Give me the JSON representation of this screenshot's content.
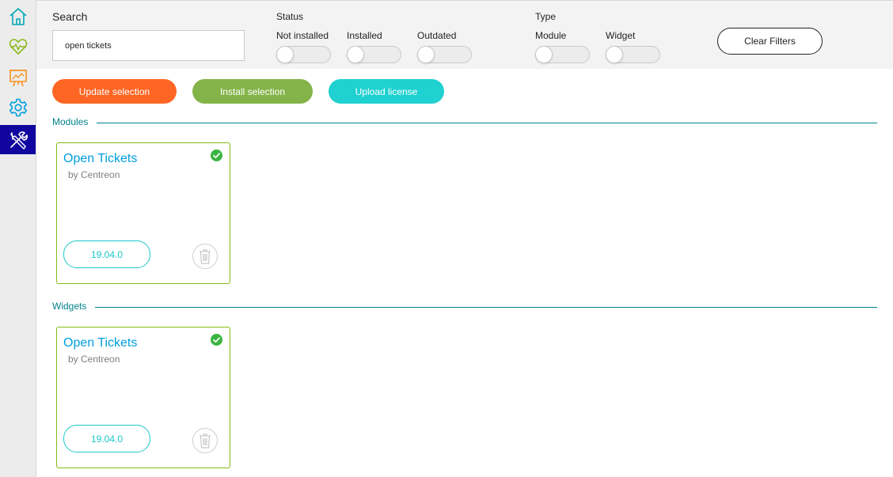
{
  "sidebar": {
    "items": [
      {
        "name": "home-icon",
        "color": "#00a8b5"
      },
      {
        "name": "monitoring-icon",
        "color": "#88b917"
      },
      {
        "name": "reporting-icon",
        "color": "#f7931e"
      },
      {
        "name": "configuration-icon",
        "color": "#009fdf"
      },
      {
        "name": "administration-icon",
        "color": "#ffffff",
        "active": true
      }
    ],
    "active_bg": "#10069f"
  },
  "filters": {
    "search": {
      "label": "Search",
      "value": "open tickets"
    },
    "status": {
      "label": "Status",
      "options": [
        {
          "label": "Not installed",
          "checked": false
        },
        {
          "label": "Installed",
          "checked": false
        },
        {
          "label": "Outdated",
          "checked": false
        }
      ]
    },
    "type": {
      "label": "Type",
      "options": [
        {
          "label": "Module",
          "checked": false
        },
        {
          "label": "Widget",
          "checked": false
        }
      ]
    },
    "clear_label": "Clear Filters"
  },
  "actions": {
    "update": {
      "label": "Update selection",
      "color": "#ff6624"
    },
    "install": {
      "label": "Install selection",
      "color": "#84b449"
    },
    "upload": {
      "label": "Upload license",
      "color": "#1fd1d0"
    }
  },
  "sections": [
    {
      "title": "Modules",
      "cards": [
        {
          "title": "Open Tickets",
          "author": "by Centreon",
          "version": "19.04.0",
          "installed": true
        }
      ]
    },
    {
      "title": "Widgets",
      "cards": [
        {
          "title": "Open Tickets",
          "author": "by Centreon",
          "version": "19.04.0",
          "installed": true
        }
      ]
    }
  ],
  "colors": {
    "accent": "#00828a",
    "card_border": "#88b917",
    "card_title": "#009fdf",
    "check": "#3cb441",
    "version": "#1bc8c8"
  }
}
